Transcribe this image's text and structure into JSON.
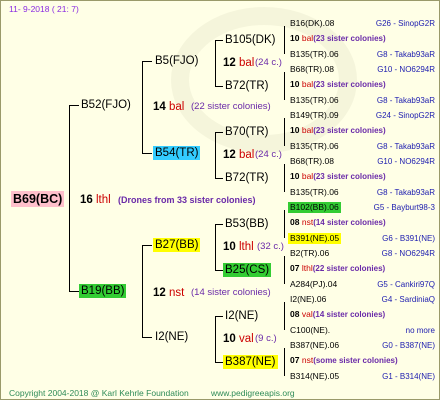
{
  "header": {
    "date": "11-  9-2018 (  21:  7)"
  },
  "footer": {
    "copyright": "Copyright 2004-2018 @ Karl Kehrle Foundation",
    "url": "www.pedigreeapis.org"
  },
  "colors": {
    "highlight_cyan": "#33ccff",
    "highlight_green": "#33cc33",
    "highlight_yellow": "#ffff00",
    "highlight_pink": "#ffc0cb"
  },
  "root": {
    "label": "B69(BC)"
  },
  "gen1": {
    "num": "16",
    "species": "lthl",
    "drones": "(Drones from 33 sister colonies)",
    "father": {
      "label": "B52(FJO)",
      "num": "14",
      "species": "bal",
      "sisters": "(22 sister colonies)"
    },
    "mother": {
      "label": "B19(BB)",
      "num": "12",
      "species": "nst",
      "sisters": "(14 sister colonies)"
    }
  },
  "gen2": {
    "b5": {
      "label": "B5(FJO)"
    },
    "b54": {
      "label": "B54(TR)"
    },
    "b27": {
      "label": "B27(BB)"
    },
    "i2": {
      "label": "I2(NE)"
    }
  },
  "gen3": {
    "b105": {
      "label": "B105(DK)",
      "num": "12",
      "species": "bal",
      "sisters": "(24 c.)"
    },
    "b72a": {
      "label": "B72(TR)"
    },
    "b70": {
      "label": "B70(TR)",
      "num": "12",
      "species": "bal",
      "sisters": "(24 c.)"
    },
    "b72b": {
      "label": "B72(TR)"
    },
    "b53": {
      "label": "B53(BB)",
      "num": "10",
      "species": "lthl",
      "sisters": "(32 c.)"
    },
    "b25": {
      "label": "B25(CS)"
    },
    "i2ne": {
      "label": "I2(NE)",
      "num": "10",
      "species": "val",
      "sisters": "(9 c.)"
    },
    "b387": {
      "label": "B387(NE)"
    }
  },
  "leaves": [
    {
      "name": "B16(DK).08",
      "code": "G26 - SinopG2R"
    },
    {
      "num": "10",
      "species": "bal",
      "sisters": "(23 sister colonies)"
    },
    {
      "name": "B135(TR).06",
      "code": "G8 - Takab93aR"
    },
    {
      "name": "B68(TR).08",
      "code": "G10 - NO6294R"
    },
    {
      "num": "10",
      "species": "bal",
      "sisters": "(23 sister colonies)"
    },
    {
      "name": "B135(TR).06",
      "code": "G8 - Takab93aR"
    },
    {
      "name": "B149(TR).09",
      "code": "G24 - SinopG2R"
    },
    {
      "num": "10",
      "species": "bal",
      "sisters": "(23 sister colonies)"
    },
    {
      "name": "B135(TR).06",
      "code": "G8 - Takab93aR"
    },
    {
      "name": "B68(TR).08",
      "code": "G10 - NO6294R"
    },
    {
      "num": "10",
      "species": "bal",
      "sisters": "(23 sister colonies)"
    },
    {
      "name": "B135(TR).06",
      "code": "G8 - Takab93aR"
    },
    {
      "name": "B102(BB).06",
      "code": "G5 - Bayburt98-3"
    },
    {
      "num": "08",
      "species": "nst",
      "sisters": "(14 sister colonies)"
    },
    {
      "name": "B391(NE).05",
      "code": "G6 - B391(NE)"
    },
    {
      "name": "B2(TR).06",
      "code": "G8 - NO6294R"
    },
    {
      "num": "07",
      "species": "lthl",
      "sisters": "(22 sister colonies)"
    },
    {
      "name": "A284(PJ).04",
      "code": "G5 - Cankiri97Q"
    },
    {
      "name": "I2(NE).06",
      "code": "G4 - SardiniaQ"
    },
    {
      "num": "08",
      "species": "val",
      "sisters": "(14 sister colonies)"
    },
    {
      "name": "C100(NE).",
      "code": "no more"
    },
    {
      "name": "B387(NE).06",
      "code": "G0 - B387(NE)"
    },
    {
      "num": "07",
      "species": "nst",
      "sisters": "(some sister colonies)"
    },
    {
      "name": "B314(NE).05",
      "code": "G1 - B314(NE)"
    }
  ]
}
